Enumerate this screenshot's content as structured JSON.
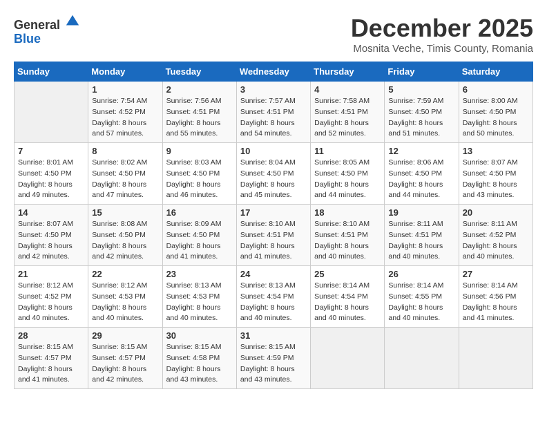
{
  "header": {
    "logo_general": "General",
    "logo_blue": "Blue",
    "month_title": "December 2025",
    "location": "Mosnita Veche, Timis County, Romania"
  },
  "weekdays": [
    "Sunday",
    "Monday",
    "Tuesday",
    "Wednesday",
    "Thursday",
    "Friday",
    "Saturday"
  ],
  "weeks": [
    [
      {
        "day": "",
        "sunrise": "",
        "sunset": "",
        "daylight": ""
      },
      {
        "day": "1",
        "sunrise": "Sunrise: 7:54 AM",
        "sunset": "Sunset: 4:52 PM",
        "daylight": "Daylight: 8 hours and 57 minutes."
      },
      {
        "day": "2",
        "sunrise": "Sunrise: 7:56 AM",
        "sunset": "Sunset: 4:51 PM",
        "daylight": "Daylight: 8 hours and 55 minutes."
      },
      {
        "day": "3",
        "sunrise": "Sunrise: 7:57 AM",
        "sunset": "Sunset: 4:51 PM",
        "daylight": "Daylight: 8 hours and 54 minutes."
      },
      {
        "day": "4",
        "sunrise": "Sunrise: 7:58 AM",
        "sunset": "Sunset: 4:51 PM",
        "daylight": "Daylight: 8 hours and 52 minutes."
      },
      {
        "day": "5",
        "sunrise": "Sunrise: 7:59 AM",
        "sunset": "Sunset: 4:50 PM",
        "daylight": "Daylight: 8 hours and 51 minutes."
      },
      {
        "day": "6",
        "sunrise": "Sunrise: 8:00 AM",
        "sunset": "Sunset: 4:50 PM",
        "daylight": "Daylight: 8 hours and 50 minutes."
      }
    ],
    [
      {
        "day": "7",
        "sunrise": "Sunrise: 8:01 AM",
        "sunset": "Sunset: 4:50 PM",
        "daylight": "Daylight: 8 hours and 49 minutes."
      },
      {
        "day": "8",
        "sunrise": "Sunrise: 8:02 AM",
        "sunset": "Sunset: 4:50 PM",
        "daylight": "Daylight: 8 hours and 47 minutes."
      },
      {
        "day": "9",
        "sunrise": "Sunrise: 8:03 AM",
        "sunset": "Sunset: 4:50 PM",
        "daylight": "Daylight: 8 hours and 46 minutes."
      },
      {
        "day": "10",
        "sunrise": "Sunrise: 8:04 AM",
        "sunset": "Sunset: 4:50 PM",
        "daylight": "Daylight: 8 hours and 45 minutes."
      },
      {
        "day": "11",
        "sunrise": "Sunrise: 8:05 AM",
        "sunset": "Sunset: 4:50 PM",
        "daylight": "Daylight: 8 hours and 44 minutes."
      },
      {
        "day": "12",
        "sunrise": "Sunrise: 8:06 AM",
        "sunset": "Sunset: 4:50 PM",
        "daylight": "Daylight: 8 hours and 44 minutes."
      },
      {
        "day": "13",
        "sunrise": "Sunrise: 8:07 AM",
        "sunset": "Sunset: 4:50 PM",
        "daylight": "Daylight: 8 hours and 43 minutes."
      }
    ],
    [
      {
        "day": "14",
        "sunrise": "Sunrise: 8:07 AM",
        "sunset": "Sunset: 4:50 PM",
        "daylight": "Daylight: 8 hours and 42 minutes."
      },
      {
        "day": "15",
        "sunrise": "Sunrise: 8:08 AM",
        "sunset": "Sunset: 4:50 PM",
        "daylight": "Daylight: 8 hours and 42 minutes."
      },
      {
        "day": "16",
        "sunrise": "Sunrise: 8:09 AM",
        "sunset": "Sunset: 4:50 PM",
        "daylight": "Daylight: 8 hours and 41 minutes."
      },
      {
        "day": "17",
        "sunrise": "Sunrise: 8:10 AM",
        "sunset": "Sunset: 4:51 PM",
        "daylight": "Daylight: 8 hours and 41 minutes."
      },
      {
        "day": "18",
        "sunrise": "Sunrise: 8:10 AM",
        "sunset": "Sunset: 4:51 PM",
        "daylight": "Daylight: 8 hours and 40 minutes."
      },
      {
        "day": "19",
        "sunrise": "Sunrise: 8:11 AM",
        "sunset": "Sunset: 4:51 PM",
        "daylight": "Daylight: 8 hours and 40 minutes."
      },
      {
        "day": "20",
        "sunrise": "Sunrise: 8:11 AM",
        "sunset": "Sunset: 4:52 PM",
        "daylight": "Daylight: 8 hours and 40 minutes."
      }
    ],
    [
      {
        "day": "21",
        "sunrise": "Sunrise: 8:12 AM",
        "sunset": "Sunset: 4:52 PM",
        "daylight": "Daylight: 8 hours and 40 minutes."
      },
      {
        "day": "22",
        "sunrise": "Sunrise: 8:12 AM",
        "sunset": "Sunset: 4:53 PM",
        "daylight": "Daylight: 8 hours and 40 minutes."
      },
      {
        "day": "23",
        "sunrise": "Sunrise: 8:13 AM",
        "sunset": "Sunset: 4:53 PM",
        "daylight": "Daylight: 8 hours and 40 minutes."
      },
      {
        "day": "24",
        "sunrise": "Sunrise: 8:13 AM",
        "sunset": "Sunset: 4:54 PM",
        "daylight": "Daylight: 8 hours and 40 minutes."
      },
      {
        "day": "25",
        "sunrise": "Sunrise: 8:14 AM",
        "sunset": "Sunset: 4:54 PM",
        "daylight": "Daylight: 8 hours and 40 minutes."
      },
      {
        "day": "26",
        "sunrise": "Sunrise: 8:14 AM",
        "sunset": "Sunset: 4:55 PM",
        "daylight": "Daylight: 8 hours and 40 minutes."
      },
      {
        "day": "27",
        "sunrise": "Sunrise: 8:14 AM",
        "sunset": "Sunset: 4:56 PM",
        "daylight": "Daylight: 8 hours and 41 minutes."
      }
    ],
    [
      {
        "day": "28",
        "sunrise": "Sunrise: 8:15 AM",
        "sunset": "Sunset: 4:57 PM",
        "daylight": "Daylight: 8 hours and 41 minutes."
      },
      {
        "day": "29",
        "sunrise": "Sunrise: 8:15 AM",
        "sunset": "Sunset: 4:57 PM",
        "daylight": "Daylight: 8 hours and 42 minutes."
      },
      {
        "day": "30",
        "sunrise": "Sunrise: 8:15 AM",
        "sunset": "Sunset: 4:58 PM",
        "daylight": "Daylight: 8 hours and 43 minutes."
      },
      {
        "day": "31",
        "sunrise": "Sunrise: 8:15 AM",
        "sunset": "Sunset: 4:59 PM",
        "daylight": "Daylight: 8 hours and 43 minutes."
      },
      {
        "day": "",
        "sunrise": "",
        "sunset": "",
        "daylight": ""
      },
      {
        "day": "",
        "sunrise": "",
        "sunset": "",
        "daylight": ""
      },
      {
        "day": "",
        "sunrise": "",
        "sunset": "",
        "daylight": ""
      }
    ]
  ]
}
